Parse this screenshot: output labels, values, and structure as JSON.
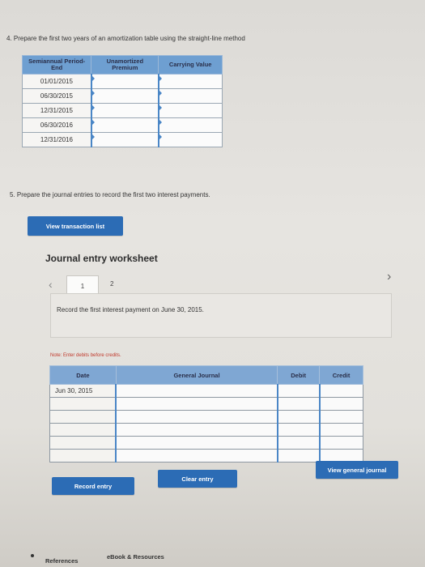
{
  "question4": {
    "text": "4. Prepare the first two years of an amortization table using the straight-line method",
    "table": {
      "headers": [
        "Semiannual Period-End",
        "Unamortized Premium",
        "Carrying Value"
      ],
      "rows": [
        "01/01/2015",
        "06/30/2015",
        "12/31/2015",
        "06/30/2016",
        "12/31/2016"
      ]
    }
  },
  "question5": {
    "text": "5. Prepare the journal entries to record the first two interest payments."
  },
  "buttons": {
    "view_transaction_list": "View transaction list",
    "record_entry": "Record entry",
    "clear_entry": "Clear entry",
    "view_general_journal": "View general journal"
  },
  "worksheet": {
    "title": "Journal entry worksheet",
    "tabs": [
      "1",
      "2"
    ],
    "instruction": "Record the first interest payment on June 30, 2015.",
    "note": "Note: Enter debits before credits.",
    "journal_headers": [
      "Date",
      "General Journal",
      "Debit",
      "Credit"
    ],
    "first_date": "Jun 30, 2015"
  },
  "footer": {
    "references": "References",
    "ebook": "eBook & Resources"
  },
  "colors": {
    "accent": "#2c6cb5",
    "table_header": "#6e9fd1"
  }
}
